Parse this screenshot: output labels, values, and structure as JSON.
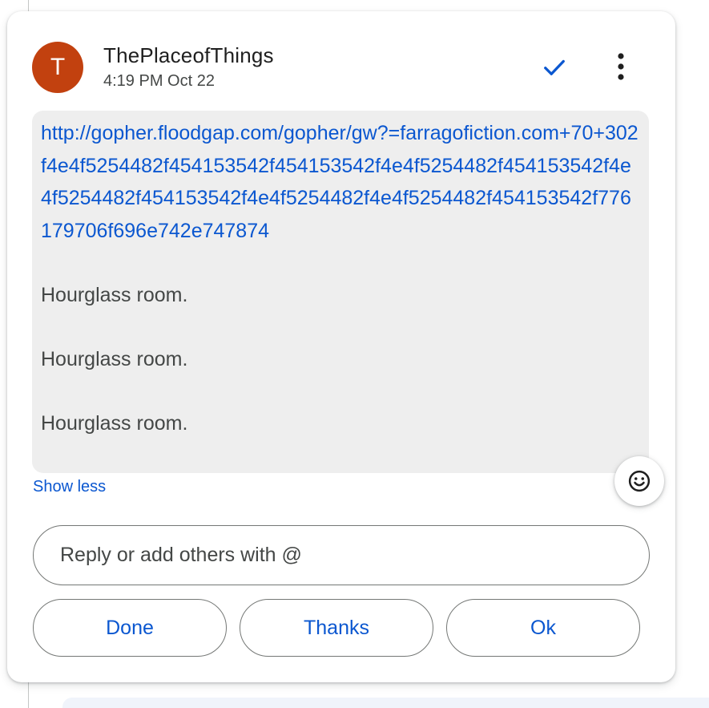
{
  "message": {
    "author": "ThePlaceofThings",
    "avatar_letter": "T",
    "timestamp": "4:19 PM Oct 22",
    "link": "http://gopher.floodgap.com/gopher/gw?=farragofiction.com+70+302f4e4f5254482f454153542f454153542f4e4f5254482f454153542f4e4f5254482f454153542f4e4f5254482f4e4f5254482f454153542f776179706f696e742e747874",
    "lines": [
      "Hourglass room.",
      "Hourglass room.",
      "Hourglass room."
    ],
    "show_less_label": "Show less"
  },
  "header_icons": {
    "resolve": "check-icon",
    "more": "more-vert-icon"
  },
  "emoji_icon": "smiley-icon",
  "reply": {
    "placeholder": "Reply or add others with @",
    "value": ""
  },
  "quick_replies": [
    "Done",
    "Thanks",
    "Ok"
  ],
  "colors": {
    "accent": "#0b57d0",
    "avatar_bg": "#c2410f",
    "bubble_bg": "#eeeeee"
  }
}
